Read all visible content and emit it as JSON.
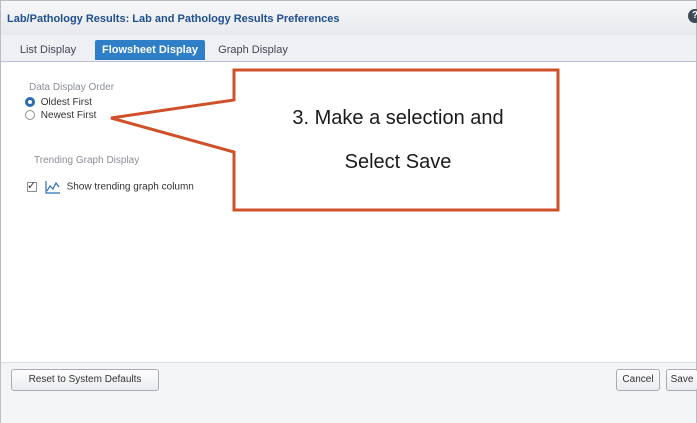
{
  "window": {
    "title": "Lab/Pathology Results: Lab and Pathology Results Preferences",
    "help_icon": "help-icon"
  },
  "tabs": [
    {
      "label": "List Display",
      "active": false
    },
    {
      "label": "Flowsheet Display",
      "active": true
    },
    {
      "label": "Graph Display",
      "active": false
    }
  ],
  "data_display_order": {
    "label": "Data Display Order",
    "options": [
      {
        "label": "Oldest First",
        "selected": true
      },
      {
        "label": "Newest First",
        "selected": false
      }
    ]
  },
  "trending": {
    "label": "Trending Graph Display",
    "checkbox_label": "Show trending graph column",
    "checked": true,
    "icon": "trend-graph-icon"
  },
  "callout": {
    "line1": "3. Make a selection and",
    "line2": "Select Save",
    "border_color": "#d0502a"
  },
  "footer": {
    "reset_label": "Reset to System Defaults",
    "cancel_label": "Cancel",
    "save_label": "Save"
  },
  "colors": {
    "accent": "#2f7fc8",
    "title": "#1f4f8e"
  }
}
